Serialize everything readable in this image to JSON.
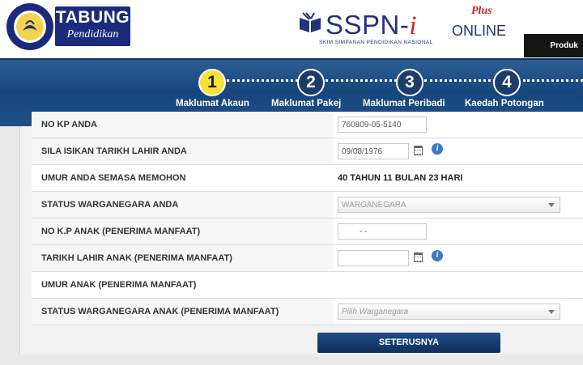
{
  "header": {
    "tabung_line1": "TABUNG",
    "tabung_line2": "Pendidikan",
    "ptptn_ring_text": "PERBADANAN TABUNG PENDIDIKAN TINGGI NASIONAL",
    "sspn_main": "SSPN-",
    "sspn_i": "i",
    "sspn_plus": "Plus",
    "sspn_online": "ONLINE",
    "sspn_subtitle": "SKIM SIMPANAN PENDIDIKAN NASIONAL",
    "produk_tab": "Produk"
  },
  "steps": [
    {
      "number": "1",
      "label": "Maklumat Akaun"
    },
    {
      "number": "2",
      "label": "Maklumat Pakej"
    },
    {
      "number": "3",
      "label": "Maklumat Peribadi"
    },
    {
      "number": "4",
      "label": "Kaedah Potongan"
    }
  ],
  "form": {
    "rows": [
      {
        "label": "NO KP ANDA",
        "value": "760809-05-5140"
      },
      {
        "label": "SILA ISIKAN TARIKH LAHIR ANDA",
        "value": "09/08/1976"
      },
      {
        "label": "UMUR ANDA SEMASA MEMOHON",
        "value": "40 TAHUN 11 BULAN 23 HARI"
      },
      {
        "label": "STATUS WARGANEGARA ANDA",
        "value": "WARGANEGARA"
      },
      {
        "label": "NO K.P ANAK (PENERIMA MANFAAT)",
        "value": "-  -"
      },
      {
        "label": "TARIKH LAHIR ANAK (PENERIMA MANFAAT)",
        "value": ""
      },
      {
        "label": "UMUR ANAK (PENERIMA MANFAAT)",
        "value": ""
      },
      {
        "label": "STATUS WARGANEGARA ANAK (PENERIMA MANFAAT)",
        "placeholder": "Pilih Warganegara"
      }
    ],
    "info_glyph": "i",
    "submit_label": "SETERUSNYA"
  }
}
